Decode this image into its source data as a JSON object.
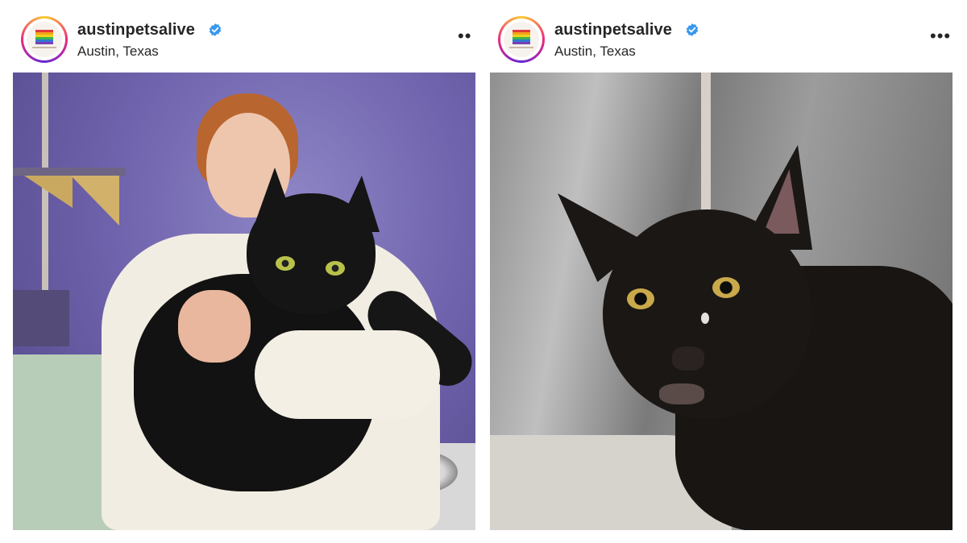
{
  "posts": [
    {
      "username": "austinpetsalive",
      "location": "Austin, Texas",
      "verified_icon": "verified-badge-icon",
      "more_icon": "more-options-icon",
      "more_label": "••",
      "photo_desc": "person-holding-black-cat"
    },
    {
      "username": "austinpetsalive",
      "location": "Austin, Texas",
      "verified_icon": "verified-badge-icon",
      "more_icon": "more-options-icon",
      "more_label": "•••",
      "photo_desc": "black-cat-in-kennel"
    }
  ],
  "colors": {
    "text": "#262626",
    "verified": "#3897f0",
    "background": "#ffffff"
  }
}
